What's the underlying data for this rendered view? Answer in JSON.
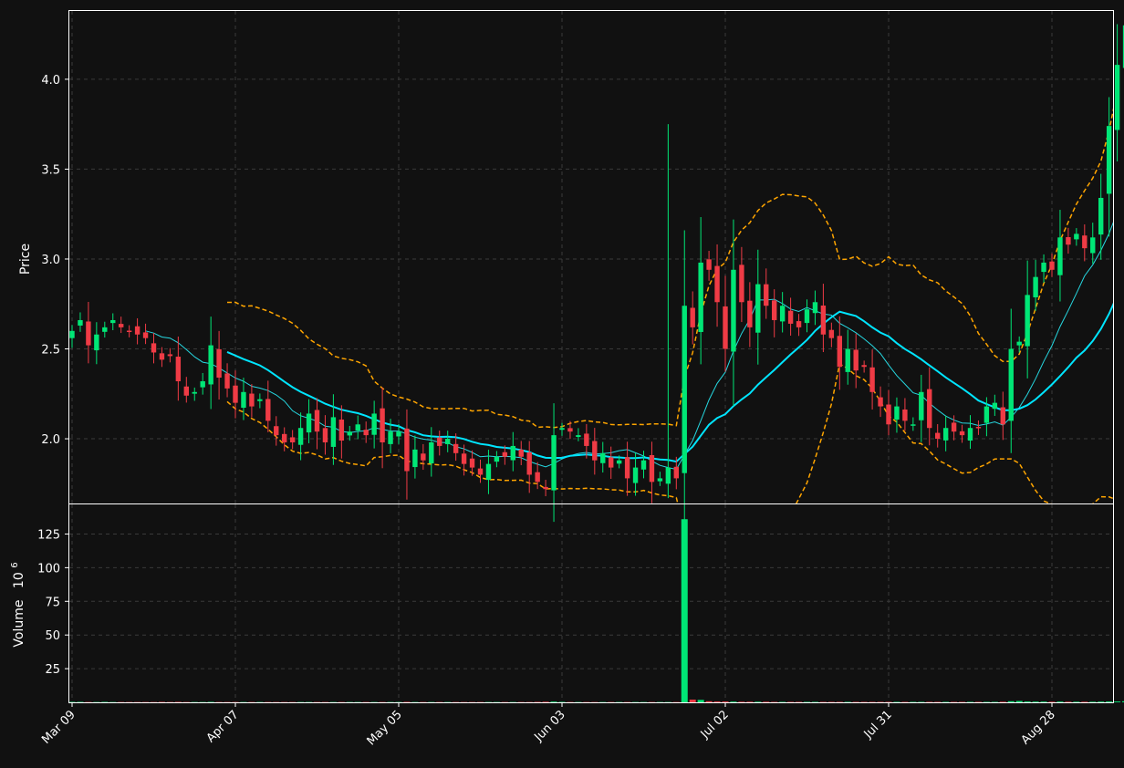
{
  "chart_data": {
    "type": "candlestick",
    "background": "#111111",
    "colors": {
      "up": "#00e676",
      "down": "#ef3b45",
      "ma_fast": "#26d7e0",
      "ma_slow": "#00e5ff",
      "bands": "#ffa500",
      "axis": "#ffffff",
      "grid": "#3a3a3a"
    },
    "price_panel": {
      "ylabel": "Price",
      "ylim": [
        1.64,
        4.38
      ],
      "yticks": [
        2.0,
        2.5,
        3.0,
        3.5,
        4.0
      ],
      "ytick_labels": [
        "2.0",
        "2.5",
        "3.0",
        "3.5",
        "4.0"
      ]
    },
    "volume_panel": {
      "ylabel": "Volume",
      "ylabel_exponent": "10",
      "ylabel_power": "6",
      "ylim": [
        0,
        147
      ],
      "yticks": [
        25,
        50,
        75,
        100,
        125
      ],
      "ytick_labels": [
        "25",
        "50",
        "75",
        "100",
        "125"
      ]
    },
    "xticks": [
      {
        "index": 0,
        "label": "Mar 09"
      },
      {
        "index": 20,
        "label": "Apr 07"
      },
      {
        "index": 40,
        "label": "May 05"
      },
      {
        "index": 60,
        "label": "Jun 03"
      },
      {
        "index": 80,
        "label": "Jul 02"
      },
      {
        "index": 100,
        "label": "Jul 31"
      },
      {
        "index": 120,
        "label": "Aug 28"
      }
    ],
    "closes": [
      2.6,
      2.66,
      2.52,
      2.58,
      2.62,
      2.66,
      2.62,
      2.6,
      2.58,
      2.56,
      2.48,
      2.44,
      2.46,
      2.32,
      2.24,
      2.26,
      2.32,
      2.52,
      2.34,
      2.28,
      2.2,
      2.26,
      2.18,
      2.22,
      2.1,
      2.02,
      1.98,
      1.98,
      2.06,
      2.14,
      2.04,
      1.98,
      2.12,
      1.99,
      2.04,
      2.08,
      2.02,
      2.14,
      1.98,
      2.04,
      2.04,
      1.82,
      1.94,
      1.88,
      1.98,
      1.96,
      2.0,
      1.92,
      1.86,
      1.84,
      1.8,
      1.86,
      1.9,
      1.9,
      1.96,
      1.9,
      1.8,
      1.76,
      1.72,
      2.02,
      2.06,
      2.04,
      2.02,
      1.96,
      1.88,
      1.92,
      1.84,
      1.88,
      1.78,
      1.84,
      1.88,
      1.76,
      1.78,
      1.84,
      1.78,
      2.74,
      2.62,
      2.98,
      2.94,
      2.76,
      2.5,
      2.94,
      2.76,
      2.62,
      2.86,
      2.74,
      2.66,
      2.74,
      2.64,
      2.62,
      2.72,
      2.76,
      2.58,
      2.56,
      2.4,
      2.5,
      2.38,
      2.4,
      2.26,
      2.18,
      2.08,
      2.18,
      2.1,
      2.08,
      2.26,
      2.06,
      2.0,
      2.06,
      2.04,
      2.02,
      2.06,
      2.06,
      2.18,
      2.2,
      2.08,
      2.5,
      2.54,
      2.8,
      2.9,
      2.98,
      2.94,
      3.12,
      3.08,
      3.14,
      3.06,
      3.12,
      3.34,
      3.74,
      4.08,
      4.3
    ],
    "volumes": [
      0.3,
      0.3,
      0.2,
      0.2,
      0.3,
      0.2,
      0.2,
      0.2,
      0.2,
      0.2,
      0.2,
      0.3,
      0.2,
      0.3,
      0.2,
      0.2,
      0.2,
      0.3,
      0.2,
      0.2,
      0.2,
      0.2,
      0.2,
      0.2,
      0.2,
      0.2,
      0.2,
      0.2,
      0.2,
      0.2,
      0.2,
      0.2,
      0.2,
      0.2,
      0.2,
      0.2,
      0.2,
      0.2,
      0.2,
      0.2,
      0.2,
      0.3,
      0.2,
      0.2,
      0.2,
      0.2,
      0.2,
      0.2,
      0.2,
      0.2,
      0.2,
      0.2,
      0.2,
      0.2,
      0.2,
      0.2,
      0.2,
      0.3,
      0.4,
      0.5,
      0.3,
      0.2,
      0.2,
      0.2,
      0.2,
      0.2,
      0.2,
      0.2,
      0.2,
      0.2,
      0.2,
      0.2,
      0.2,
      0.2,
      0.2,
      136,
      2.0,
      1.8,
      0.8,
      0.6,
      0.6,
      0.5,
      0.4,
      0.4,
      0.4,
      0.4,
      0.3,
      0.3,
      0.3,
      0.3,
      0.3,
      0.3,
      0.3,
      0.3,
      0.3,
      0.3,
      0.3,
      0.3,
      0.3,
      0.3,
      0.3,
      0.3,
      0.3,
      0.3,
      0.3,
      0.3,
      0.3,
      0.3,
      0.3,
      0.3,
      0.3,
      0.3,
      0.3,
      0.3,
      0.4,
      0.8,
      1.0,
      0.6,
      0.5,
      0.5,
      0.4,
      0.5,
      0.4,
      0.4,
      0.4,
      0.4,
      0.5,
      0.6,
      0.6,
      0.8
    ]
  }
}
